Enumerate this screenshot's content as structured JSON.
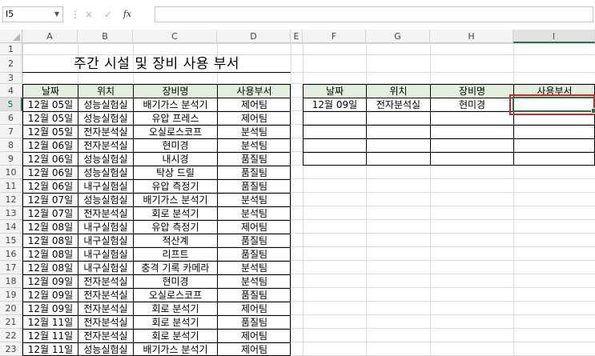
{
  "formula_bar": {
    "cell_ref": "I5",
    "separator": "⋮",
    "cancel_icon": "×",
    "enter_icon": "✓",
    "fx_label": "fx",
    "formula": ""
  },
  "columns": [
    "A",
    "B",
    "C",
    "D",
    "E",
    "F",
    "G",
    "H",
    "I"
  ],
  "rows": [
    "1",
    "2",
    "3",
    "4",
    "5",
    "6",
    "7",
    "8",
    "9",
    "10",
    "11",
    "12",
    "13",
    "14",
    "15",
    "16",
    "17",
    "18",
    "19",
    "20",
    "21",
    "22",
    "23"
  ],
  "selected_cell": "I5",
  "main_table": {
    "title": "주간 시설 및 장비 사용 부서",
    "headers": [
      "날짜",
      "위치",
      "장비명",
      "사용부서"
    ],
    "rows": [
      [
        "12월 05일",
        "성능실험실",
        "배기가스 분석기",
        "제어팀"
      ],
      [
        "12월 05일",
        "성능실험실",
        "유압 프레스",
        "제어팀"
      ],
      [
        "12월 05일",
        "전자분석실",
        "오실로스코프",
        "분석팀"
      ],
      [
        "12월 06일",
        "전자분석실",
        "현미경",
        "분석팀"
      ],
      [
        "12월 06일",
        "성능실험실",
        "내시경",
        "품질팀"
      ],
      [
        "12월 06일",
        "성능실험실",
        "탁상 드릴",
        "품질팀"
      ],
      [
        "12월 06일",
        "내구실험실",
        "유압 측정기",
        "품질팀"
      ],
      [
        "12월 07일",
        "성능실험실",
        "배기가스 분석기",
        "분석팀"
      ],
      [
        "12월 07일",
        "전자분석실",
        "회로 분석기",
        "분석팀"
      ],
      [
        "12월 08일",
        "내구실험실",
        "유압 측정기",
        "제어팀"
      ],
      [
        "12월 08일",
        "내구실험실",
        "적산계",
        "품질팀"
      ],
      [
        "12월 08일",
        "내구실험실",
        "리프트",
        "품질팀"
      ],
      [
        "12월 08일",
        "내구실험실",
        "충격 기록 카메라",
        "분석팀"
      ],
      [
        "12월 09일",
        "전자분석실",
        "현미경",
        "분석팀"
      ],
      [
        "12월 09일",
        "전자분석실",
        "오실로스코프",
        "품질팀"
      ],
      [
        "12월 09일",
        "전자분석실",
        "회로 분석기",
        "제어팀"
      ],
      [
        "12월 11일",
        "전자분석실",
        "회로 분석기",
        "품질팀"
      ],
      [
        "12월 11일",
        "전자분석실",
        "회로 분석기",
        "제어팀"
      ],
      [
        "12월 11일",
        "성능실험실",
        "배기가스 분석기",
        "제어팀"
      ]
    ]
  },
  "lookup_table": {
    "headers": [
      "날짜",
      "위치",
      "장비명",
      "사용부서"
    ],
    "rows": [
      [
        "12월 09일",
        "전자분석실",
        "현미경",
        ""
      ],
      [
        "",
        "",
        "",
        ""
      ],
      [
        "",
        "",
        "",
        ""
      ],
      [
        "",
        "",
        "",
        ""
      ],
      [
        "",
        "",
        "",
        ""
      ]
    ]
  }
}
